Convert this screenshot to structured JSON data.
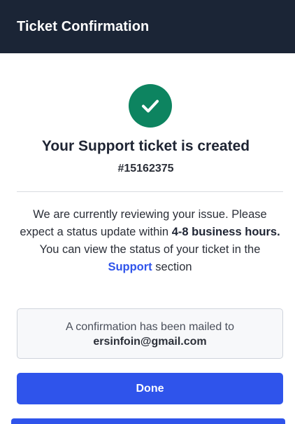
{
  "header": {
    "title": "Ticket Confirmation"
  },
  "confirmation": {
    "icon": "check-circle-icon",
    "title": "Your Support ticket is created",
    "ticket_number": "#15162375"
  },
  "message": {
    "line1_prefix": "We are currently reviewing your issue. Please expect a status update within ",
    "eta": "4-8 business hours.",
    "line2_prefix": "You can view the status of your ticket in the ",
    "support_link": "Support",
    "line2_suffix": " section"
  },
  "mail_notice": {
    "text": "A confirmation has been mailed to",
    "email": "ersinfoin@gmail.com"
  },
  "actions": {
    "done_label": "Done"
  },
  "colors": {
    "header_bg": "#1b2536",
    "accent": "#2f54eb",
    "success": "#0d8460"
  }
}
